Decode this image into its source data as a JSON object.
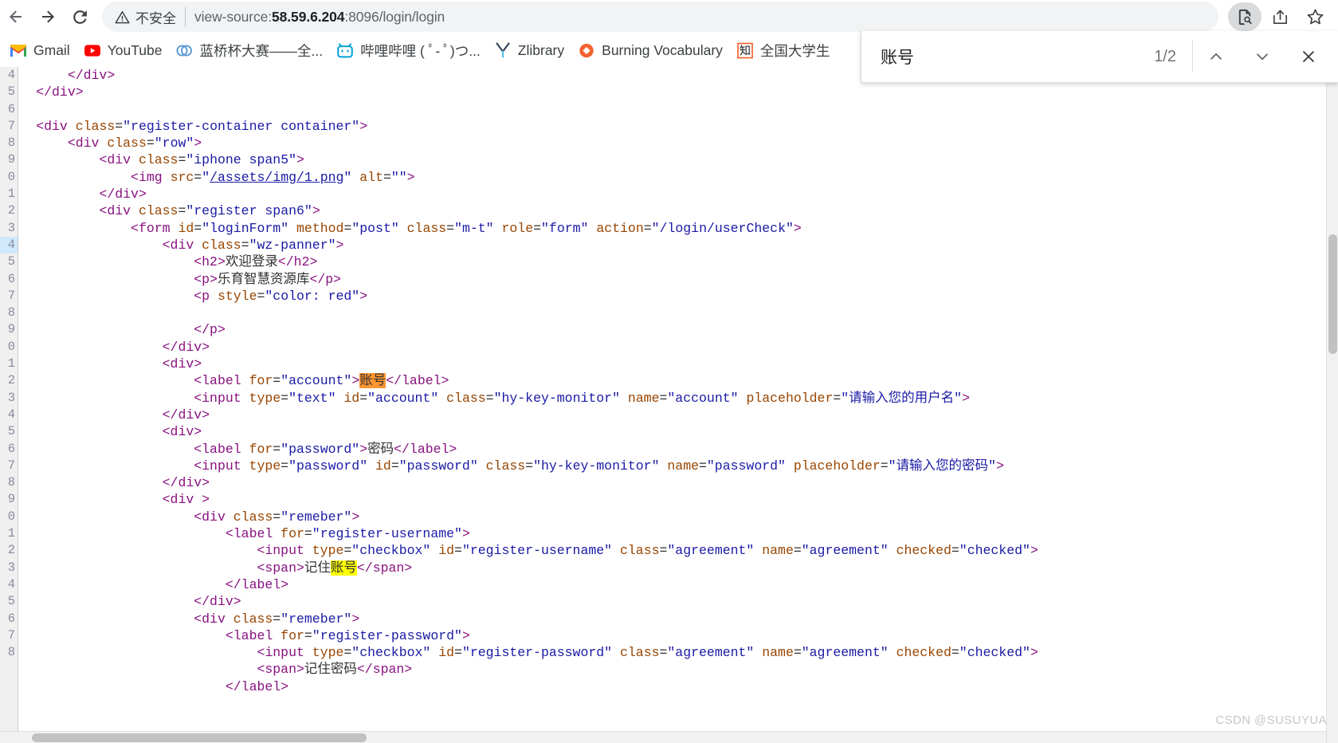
{
  "browser": {
    "back_label": "Back",
    "forward_label": "Forward",
    "reload_label": "Reload",
    "insecure_label": "不安全",
    "url_prefix": "view-source:",
    "url_host": "58.59.6.204",
    "url_suffix": ":8096/login/login",
    "url_full": "view-source:58.59.6.204:8096/login/login",
    "find_icon_name": "find-in-page-icon",
    "share_icon_name": "share-icon",
    "bookmark_icon_name": "bookmark-star-icon"
  },
  "bookmarks": [
    {
      "label": "Gmail",
      "icon": "gmail-icon"
    },
    {
      "label": "YouTube",
      "icon": "youtube-icon"
    },
    {
      "label": "蓝桥杯大赛——全...",
      "icon": "lanqiao-icon"
    },
    {
      "label": "哔哩哔哩 ( ﾟ- ﾟ)つ...",
      "icon": "bilibili-icon"
    },
    {
      "label": "Zlibrary",
      "icon": "zlibrary-icon"
    },
    {
      "label": "Burning Vocabulary",
      "icon": "burning-vocabulary-icon"
    },
    {
      "label": "全国大学生",
      "icon": "zhi-icon"
    }
  ],
  "find_bar": {
    "query": "账号",
    "placeholder": "",
    "match_counter": "1/2",
    "prev_label": "Previous match",
    "next_label": "Next match",
    "close_label": "Close find bar"
  },
  "source": {
    "line_numbers": [
      "4",
      "5",
      "6",
      "7",
      "8",
      "9",
      "0",
      "1",
      "2",
      "3",
      "4",
      "5",
      "6",
      "7",
      "8",
      "9",
      "0",
      "1",
      "2",
      "3",
      "4",
      "5",
      "6",
      "7",
      "8",
      "9",
      "0",
      "1",
      "2",
      "3",
      "4",
      "5",
      "6",
      "7",
      "8"
    ],
    "highlighted_line_index": 10,
    "lines": [
      [
        {
          "t": "            ",
          "c": "tk-txt"
        },
        {
          "t": "</div>",
          "c": "tk-tag"
        }
      ],
      [
        {
          "t": "        ",
          "c": "tk-txt"
        },
        {
          "t": "</div>",
          "c": "tk-tag"
        }
      ],
      [],
      [
        {
          "t": "        ",
          "c": "tk-txt"
        },
        {
          "t": "<div ",
          "c": "tk-tag"
        },
        {
          "t": "class",
          "c": "tk-attr"
        },
        {
          "t": "=",
          "c": "tk-eq"
        },
        {
          "t": "\"register-container container\"",
          "c": "tk-val"
        },
        {
          "t": ">",
          "c": "tk-tag"
        }
      ],
      [
        {
          "t": "            ",
          "c": "tk-txt"
        },
        {
          "t": "<div ",
          "c": "tk-tag"
        },
        {
          "t": "class",
          "c": "tk-attr"
        },
        {
          "t": "=",
          "c": "tk-eq"
        },
        {
          "t": "\"row\"",
          "c": "tk-val"
        },
        {
          "t": ">",
          "c": "tk-tag"
        }
      ],
      [
        {
          "t": "                ",
          "c": "tk-txt"
        },
        {
          "t": "<div ",
          "c": "tk-tag"
        },
        {
          "t": "class",
          "c": "tk-attr"
        },
        {
          "t": "=",
          "c": "tk-eq"
        },
        {
          "t": "\"iphone span5\"",
          "c": "tk-val"
        },
        {
          "t": ">",
          "c": "tk-tag"
        }
      ],
      [
        {
          "t": "                    ",
          "c": "tk-txt"
        },
        {
          "t": "<img ",
          "c": "tk-tag"
        },
        {
          "t": "src",
          "c": "tk-attr"
        },
        {
          "t": "=",
          "c": "tk-eq"
        },
        {
          "t": "\"",
          "c": "tk-val"
        },
        {
          "t": "/assets/img/1.png",
          "c": "tk-link"
        },
        {
          "t": "\" ",
          "c": "tk-val"
        },
        {
          "t": "alt",
          "c": "tk-attr"
        },
        {
          "t": "=",
          "c": "tk-eq"
        },
        {
          "t": "\"\"",
          "c": "tk-val"
        },
        {
          "t": ">",
          "c": "tk-tag"
        }
      ],
      [
        {
          "t": "                ",
          "c": "tk-txt"
        },
        {
          "t": "</div>",
          "c": "tk-tag"
        }
      ],
      [
        {
          "t": "                ",
          "c": "tk-txt"
        },
        {
          "t": "<div ",
          "c": "tk-tag"
        },
        {
          "t": "class",
          "c": "tk-attr"
        },
        {
          "t": "=",
          "c": "tk-eq"
        },
        {
          "t": "\"register span6\"",
          "c": "tk-val"
        },
        {
          "t": ">",
          "c": "tk-tag"
        }
      ],
      [
        {
          "t": "                    ",
          "c": "tk-txt"
        },
        {
          "t": "<form ",
          "c": "tk-tag"
        },
        {
          "t": "id",
          "c": "tk-attr"
        },
        {
          "t": "=",
          "c": "tk-eq"
        },
        {
          "t": "\"loginForm\" ",
          "c": "tk-val"
        },
        {
          "t": "method",
          "c": "tk-attr"
        },
        {
          "t": "=",
          "c": "tk-eq"
        },
        {
          "t": "\"post\" ",
          "c": "tk-val"
        },
        {
          "t": "class",
          "c": "tk-attr"
        },
        {
          "t": "=",
          "c": "tk-eq"
        },
        {
          "t": "\"m-t\" ",
          "c": "tk-val"
        },
        {
          "t": "role",
          "c": "tk-attr"
        },
        {
          "t": "=",
          "c": "tk-eq"
        },
        {
          "t": "\"form\" ",
          "c": "tk-val"
        },
        {
          "t": "action",
          "c": "tk-attr"
        },
        {
          "t": "=",
          "c": "tk-eq"
        },
        {
          "t": "\"/login/userCheck\"",
          "c": "tk-val"
        },
        {
          "t": ">",
          "c": "tk-tag"
        }
      ],
      [
        {
          "t": "                        ",
          "c": "tk-txt"
        },
        {
          "t": "<div ",
          "c": "tk-tag"
        },
        {
          "t": "class",
          "c": "tk-attr"
        },
        {
          "t": "=",
          "c": "tk-eq"
        },
        {
          "t": "\"wz-panner\"",
          "c": "tk-val"
        },
        {
          "t": ">",
          "c": "tk-tag"
        }
      ],
      [
        {
          "t": "                            ",
          "c": "tk-txt"
        },
        {
          "t": "<h2>",
          "c": "tk-tag"
        },
        {
          "t": "欢迎登录",
          "c": "tk-txt"
        },
        {
          "t": "</h2>",
          "c": "tk-tag"
        }
      ],
      [
        {
          "t": "                            ",
          "c": "tk-txt"
        },
        {
          "t": "<p>",
          "c": "tk-tag"
        },
        {
          "t": "乐育智慧资源库",
          "c": "tk-txt"
        },
        {
          "t": "</p>",
          "c": "tk-tag"
        }
      ],
      [
        {
          "t": "                            ",
          "c": "tk-txt"
        },
        {
          "t": "<p ",
          "c": "tk-tag"
        },
        {
          "t": "style",
          "c": "tk-attr"
        },
        {
          "t": "=",
          "c": "tk-eq"
        },
        {
          "t": "\"color: red\"",
          "c": "tk-val"
        },
        {
          "t": ">",
          "c": "tk-tag"
        }
      ],
      [],
      [
        {
          "t": "                            ",
          "c": "tk-txt"
        },
        {
          "t": "</p>",
          "c": "tk-tag"
        }
      ],
      [
        {
          "t": "                        ",
          "c": "tk-txt"
        },
        {
          "t": "</div>",
          "c": "tk-tag"
        }
      ],
      [
        {
          "t": "                        ",
          "c": "tk-txt"
        },
        {
          "t": "<div>",
          "c": "tk-tag"
        }
      ],
      [
        {
          "t": "                            ",
          "c": "tk-txt"
        },
        {
          "t": "<label ",
          "c": "tk-tag"
        },
        {
          "t": "for",
          "c": "tk-attr"
        },
        {
          "t": "=",
          "c": "tk-eq"
        },
        {
          "t": "\"account\"",
          "c": "tk-val"
        },
        {
          "t": ">",
          "c": "tk-tag"
        },
        {
          "t": "账号",
          "c": "hit-active"
        },
        {
          "t": "</label>",
          "c": "tk-tag"
        }
      ],
      [
        {
          "t": "                            ",
          "c": "tk-txt"
        },
        {
          "t": "<input ",
          "c": "tk-tag"
        },
        {
          "t": "type",
          "c": "tk-attr"
        },
        {
          "t": "=",
          "c": "tk-eq"
        },
        {
          "t": "\"text\" ",
          "c": "tk-val"
        },
        {
          "t": "id",
          "c": "tk-attr"
        },
        {
          "t": "=",
          "c": "tk-eq"
        },
        {
          "t": "\"account\" ",
          "c": "tk-val"
        },
        {
          "t": "class",
          "c": "tk-attr"
        },
        {
          "t": "=",
          "c": "tk-eq"
        },
        {
          "t": "\"hy-key-monitor\" ",
          "c": "tk-val"
        },
        {
          "t": "name",
          "c": "tk-attr"
        },
        {
          "t": "=",
          "c": "tk-eq"
        },
        {
          "t": "\"account\" ",
          "c": "tk-val"
        },
        {
          "t": "placeholder",
          "c": "tk-attr"
        },
        {
          "t": "=",
          "c": "tk-eq"
        },
        {
          "t": "\"请输入您的用户名\"",
          "c": "tk-val"
        },
        {
          "t": ">",
          "c": "tk-tag"
        }
      ],
      [
        {
          "t": "                        ",
          "c": "tk-txt"
        },
        {
          "t": "</div>",
          "c": "tk-tag"
        }
      ],
      [
        {
          "t": "                        ",
          "c": "tk-txt"
        },
        {
          "t": "<div>",
          "c": "tk-tag"
        }
      ],
      [
        {
          "t": "                            ",
          "c": "tk-txt"
        },
        {
          "t": "<label ",
          "c": "tk-tag"
        },
        {
          "t": "for",
          "c": "tk-attr"
        },
        {
          "t": "=",
          "c": "tk-eq"
        },
        {
          "t": "\"password\"",
          "c": "tk-val"
        },
        {
          "t": ">",
          "c": "tk-tag"
        },
        {
          "t": "密码",
          "c": "tk-txt"
        },
        {
          "t": "</label>",
          "c": "tk-tag"
        }
      ],
      [
        {
          "t": "                            ",
          "c": "tk-txt"
        },
        {
          "t": "<input ",
          "c": "tk-tag"
        },
        {
          "t": "type",
          "c": "tk-attr"
        },
        {
          "t": "=",
          "c": "tk-eq"
        },
        {
          "t": "\"password\" ",
          "c": "tk-val"
        },
        {
          "t": "id",
          "c": "tk-attr"
        },
        {
          "t": "=",
          "c": "tk-eq"
        },
        {
          "t": "\"password\" ",
          "c": "tk-val"
        },
        {
          "t": "class",
          "c": "tk-attr"
        },
        {
          "t": "=",
          "c": "tk-eq"
        },
        {
          "t": "\"hy-key-monitor\" ",
          "c": "tk-val"
        },
        {
          "t": "name",
          "c": "tk-attr"
        },
        {
          "t": "=",
          "c": "tk-eq"
        },
        {
          "t": "\"password\" ",
          "c": "tk-val"
        },
        {
          "t": "placeholder",
          "c": "tk-attr"
        },
        {
          "t": "=",
          "c": "tk-eq"
        },
        {
          "t": "\"请输入您的密码\"",
          "c": "tk-val"
        },
        {
          "t": ">",
          "c": "tk-tag"
        }
      ],
      [
        {
          "t": "                        ",
          "c": "tk-txt"
        },
        {
          "t": "</div>",
          "c": "tk-tag"
        }
      ],
      [
        {
          "t": "                        ",
          "c": "tk-txt"
        },
        {
          "t": "<div >",
          "c": "tk-tag"
        }
      ],
      [
        {
          "t": "                            ",
          "c": "tk-txt"
        },
        {
          "t": "<div ",
          "c": "tk-tag"
        },
        {
          "t": "class",
          "c": "tk-attr"
        },
        {
          "t": "=",
          "c": "tk-eq"
        },
        {
          "t": "\"remeber\"",
          "c": "tk-val"
        },
        {
          "t": ">",
          "c": "tk-tag"
        }
      ],
      [
        {
          "t": "                                ",
          "c": "tk-txt"
        },
        {
          "t": "<label ",
          "c": "tk-tag"
        },
        {
          "t": "for",
          "c": "tk-attr"
        },
        {
          "t": "=",
          "c": "tk-eq"
        },
        {
          "t": "\"register-username\"",
          "c": "tk-val"
        },
        {
          "t": ">",
          "c": "tk-tag"
        }
      ],
      [
        {
          "t": "                                    ",
          "c": "tk-txt"
        },
        {
          "t": "<input ",
          "c": "tk-tag"
        },
        {
          "t": "type",
          "c": "tk-attr"
        },
        {
          "t": "=",
          "c": "tk-eq"
        },
        {
          "t": "\"checkbox\" ",
          "c": "tk-val"
        },
        {
          "t": "id",
          "c": "tk-attr"
        },
        {
          "t": "=",
          "c": "tk-eq"
        },
        {
          "t": "\"register-username\" ",
          "c": "tk-val"
        },
        {
          "t": "class",
          "c": "tk-attr"
        },
        {
          "t": "=",
          "c": "tk-eq"
        },
        {
          "t": "\"agreement\" ",
          "c": "tk-val"
        },
        {
          "t": "name",
          "c": "tk-attr"
        },
        {
          "t": "=",
          "c": "tk-eq"
        },
        {
          "t": "\"agreement\" ",
          "c": "tk-val"
        },
        {
          "t": "checked",
          "c": "tk-attr"
        },
        {
          "t": "=",
          "c": "tk-eq"
        },
        {
          "t": "\"checked\"",
          "c": "tk-val"
        },
        {
          "t": ">",
          "c": "tk-tag"
        }
      ],
      [
        {
          "t": "                                    ",
          "c": "tk-txt"
        },
        {
          "t": "<span>",
          "c": "tk-tag"
        },
        {
          "t": "记住",
          "c": "tk-txt"
        },
        {
          "t": "账号",
          "c": "hit"
        },
        {
          "t": "</span>",
          "c": "tk-tag"
        }
      ],
      [
        {
          "t": "                                ",
          "c": "tk-txt"
        },
        {
          "t": "</label>",
          "c": "tk-tag"
        }
      ],
      [
        {
          "t": "                            ",
          "c": "tk-txt"
        },
        {
          "t": "</div>",
          "c": "tk-tag"
        }
      ],
      [
        {
          "t": "                            ",
          "c": "tk-txt"
        },
        {
          "t": "<div ",
          "c": "tk-tag"
        },
        {
          "t": "class",
          "c": "tk-attr"
        },
        {
          "t": "=",
          "c": "tk-eq"
        },
        {
          "t": "\"remeber\"",
          "c": "tk-val"
        },
        {
          "t": ">",
          "c": "tk-tag"
        }
      ],
      [
        {
          "t": "                                ",
          "c": "tk-txt"
        },
        {
          "t": "<label ",
          "c": "tk-tag"
        },
        {
          "t": "for",
          "c": "tk-attr"
        },
        {
          "t": "=",
          "c": "tk-eq"
        },
        {
          "t": "\"register-password\"",
          "c": "tk-val"
        },
        {
          "t": ">",
          "c": "tk-tag"
        }
      ],
      [
        {
          "t": "                                    ",
          "c": "tk-txt"
        },
        {
          "t": "<input ",
          "c": "tk-tag"
        },
        {
          "t": "type",
          "c": "tk-attr"
        },
        {
          "t": "=",
          "c": "tk-eq"
        },
        {
          "t": "\"checkbox\" ",
          "c": "tk-val"
        },
        {
          "t": "id",
          "c": "tk-attr"
        },
        {
          "t": "=",
          "c": "tk-eq"
        },
        {
          "t": "\"register-password\" ",
          "c": "tk-val"
        },
        {
          "t": "class",
          "c": "tk-attr"
        },
        {
          "t": "=",
          "c": "tk-eq"
        },
        {
          "t": "\"agreement\" ",
          "c": "tk-val"
        },
        {
          "t": "name",
          "c": "tk-attr"
        },
        {
          "t": "=",
          "c": "tk-eq"
        },
        {
          "t": "\"agreement\" ",
          "c": "tk-val"
        },
        {
          "t": "checked",
          "c": "tk-attr"
        },
        {
          "t": "=",
          "c": "tk-eq"
        },
        {
          "t": "\"checked\"",
          "c": "tk-val"
        },
        {
          "t": ">",
          "c": "tk-tag"
        }
      ],
      [
        {
          "t": "                                    ",
          "c": "tk-txt"
        },
        {
          "t": "<span>",
          "c": "tk-tag"
        },
        {
          "t": "记住密码",
          "c": "tk-txt"
        },
        {
          "t": "</span>",
          "c": "tk-tag"
        }
      ],
      [
        {
          "t": "                                ",
          "c": "tk-txt"
        },
        {
          "t": "</label>",
          "c": "tk-tag"
        }
      ]
    ]
  },
  "watermark": "CSDN @SUSUYUA",
  "colors": {
    "find_active_highlight": "#ff9632",
    "find_highlight": "#ffff00",
    "tag": "#881280",
    "attr": "#994500",
    "value": "#1a1aa6",
    "omnibox_bg": "#f1f3f4"
  }
}
